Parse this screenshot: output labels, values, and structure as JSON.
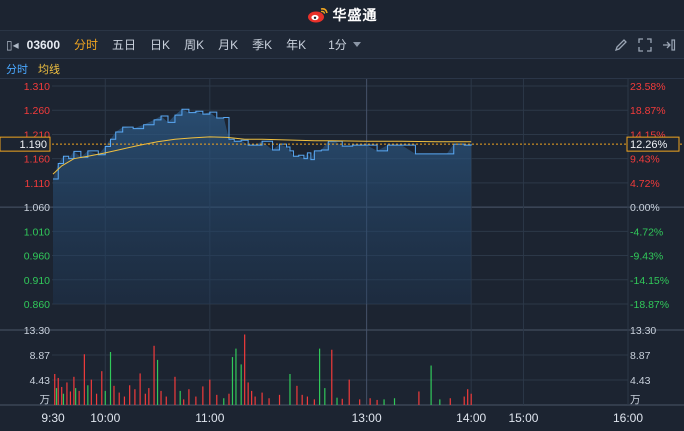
{
  "header": {
    "brand": "华盛通"
  },
  "toolbar": {
    "code": "03600",
    "tabs": [
      "分时",
      "五日",
      "日K",
      "周K",
      "月K",
      "季K",
      "年K"
    ],
    "active_tab": "分时",
    "interval": "1分"
  },
  "legend": {
    "intraday": "分时",
    "average": "均线"
  },
  "colors": {
    "up": "#f23b3b",
    "down": "#31c95a",
    "price": "#5aa9f5",
    "avg": "#f0c040",
    "bg": "#1c2431"
  },
  "chart_data": {
    "type": "line",
    "prev_close": 1.06,
    "current_price": "1.190",
    "current_pct": "12.26%",
    "price_ticks": [
      "1.310",
      "1.260",
      "1.210",
      "1.160",
      "1.110",
      "1.060",
      "1.010",
      "0.960",
      "0.910",
      "0.860"
    ],
    "pct_ticks": [
      "23.58%",
      "18.87%",
      "14.15%",
      "9.43%",
      "4.72%",
      "0.00%",
      "-4.72%",
      "-9.43%",
      "-14.15%",
      "-18.87%"
    ],
    "volume_ticks": [
      "13.30",
      "8.87",
      "4.43"
    ],
    "volume_unit": "万",
    "time_labels": [
      "9:30",
      "10:00",
      "11:00",
      "13:00",
      "14:00",
      "15:00",
      "16:00"
    ],
    "price_series": [
      [
        0,
        1.118
      ],
      [
        3,
        1.15
      ],
      [
        6,
        1.165
      ],
      [
        9,
        1.16
      ],
      [
        12,
        1.175
      ],
      [
        16,
        1.163
      ],
      [
        20,
        1.176
      ],
      [
        26,
        1.168
      ],
      [
        30,
        1.185
      ],
      [
        33,
        1.2
      ],
      [
        36,
        1.215
      ],
      [
        40,
        1.225
      ],
      [
        46,
        1.222
      ],
      [
        52,
        1.23
      ],
      [
        58,
        1.24
      ],
      [
        62,
        1.248
      ],
      [
        66,
        1.235
      ],
      [
        70,
        1.25
      ],
      [
        74,
        1.262
      ],
      [
        78,
        1.255
      ],
      [
        82,
        1.258
      ],
      [
        86,
        1.252
      ],
      [
        90,
        1.256
      ],
      [
        94,
        1.244
      ],
      [
        98,
        1.245
      ],
      [
        101,
        1.2
      ],
      [
        104,
        1.196
      ],
      [
        108,
        1.198
      ],
      [
        112,
        1.188
      ],
      [
        116,
        1.188
      ],
      [
        120,
        1.196
      ],
      [
        126,
        1.178
      ],
      [
        130,
        1.19
      ],
      [
        134,
        1.184
      ],
      [
        136,
        1.176
      ],
      [
        138,
        1.165
      ],
      [
        141,
        1.167
      ],
      [
        144,
        1.16
      ],
      [
        146,
        1.172
      ],
      [
        148,
        1.158
      ],
      [
        150,
        1.176
      ],
      [
        154,
        1.178
      ],
      [
        158,
        1.196
      ],
      [
        162,
        1.196
      ],
      [
        166,
        1.186
      ],
      [
        172,
        1.188
      ],
      [
        180,
        1.188
      ],
      [
        186,
        1.176
      ],
      [
        192,
        1.188
      ],
      [
        200,
        1.188
      ],
      [
        208,
        1.17
      ],
      [
        218,
        1.17
      ],
      [
        226,
        1.17
      ],
      [
        230,
        1.19
      ],
      [
        236,
        1.188
      ],
      [
        240,
        1.19
      ]
    ],
    "avg_series": [
      [
        0,
        1.128
      ],
      [
        5,
        1.145
      ],
      [
        12,
        1.16
      ],
      [
        20,
        1.165
      ],
      [
        30,
        1.172
      ],
      [
        40,
        1.18
      ],
      [
        50,
        1.188
      ],
      [
        60,
        1.195
      ],
      [
        70,
        1.2
      ],
      [
        80,
        1.203
      ],
      [
        90,
        1.205
      ],
      [
        100,
        1.204
      ],
      [
        110,
        1.2
      ],
      [
        120,
        1.2
      ],
      [
        130,
        1.199
      ],
      [
        140,
        1.198
      ],
      [
        150,
        1.197
      ],
      [
        160,
        1.197
      ],
      [
        180,
        1.196
      ],
      [
        200,
        1.196
      ],
      [
        220,
        1.195
      ],
      [
        240,
        1.195
      ]
    ],
    "volume_series": [
      [
        1,
        5.5,
        "up"
      ],
      [
        2,
        3.0,
        "down"
      ],
      [
        3,
        4.8,
        "up"
      ],
      [
        5,
        3.2,
        "up"
      ],
      [
        6,
        2.0,
        "down"
      ],
      [
        8,
        4.0,
        "up"
      ],
      [
        10,
        2.4,
        "up"
      ],
      [
        12,
        5.0,
        "up"
      ],
      [
        13,
        3.0,
        "down"
      ],
      [
        15,
        2.5,
        "up"
      ],
      [
        18,
        9.0,
        "up"
      ],
      [
        20,
        3.5,
        "down"
      ],
      [
        22,
        4.5,
        "up"
      ],
      [
        25,
        2.0,
        "up"
      ],
      [
        28,
        6.0,
        "up"
      ],
      [
        30,
        2.5,
        "down"
      ],
      [
        33,
        9.4,
        "down"
      ],
      [
        35,
        3.4,
        "up"
      ],
      [
        38,
        2.2,
        "up"
      ],
      [
        41,
        1.5,
        "up"
      ],
      [
        44,
        3.5,
        "up"
      ],
      [
        47,
        2.8,
        "up"
      ],
      [
        50,
        5.6,
        "up"
      ],
      [
        53,
        2.0,
        "up"
      ],
      [
        55,
        3.0,
        "up"
      ],
      [
        58,
        10.5,
        "up"
      ],
      [
        60,
        8.0,
        "down"
      ],
      [
        62,
        2.5,
        "up"
      ],
      [
        65,
        1.5,
        "up"
      ],
      [
        70,
        5.0,
        "up"
      ],
      [
        73,
        2.5,
        "down"
      ],
      [
        75,
        1.0,
        "up"
      ],
      [
        78,
        2.8,
        "up"
      ],
      [
        82,
        1.5,
        "up"
      ],
      [
        86,
        3.3,
        "up"
      ],
      [
        90,
        4.5,
        "up"
      ],
      [
        94,
        1.8,
        "up"
      ],
      [
        98,
        1.2,
        "down"
      ],
      [
        101,
        2.0,
        "up"
      ],
      [
        103,
        8.5,
        "down"
      ],
      [
        105,
        10.0,
        "down"
      ],
      [
        108,
        7.2,
        "down"
      ],
      [
        110,
        12.5,
        "up"
      ],
      [
        112,
        4.0,
        "up"
      ],
      [
        114,
        2.5,
        "up"
      ],
      [
        116,
        1.5,
        "up"
      ],
      [
        120,
        2.2,
        "up"
      ],
      [
        124,
        1.2,
        "up"
      ],
      [
        130,
        1.8,
        "up"
      ],
      [
        136,
        5.5,
        "down"
      ],
      [
        140,
        3.4,
        "up"
      ],
      [
        143,
        1.8,
        "up"
      ],
      [
        146,
        1.5,
        "up"
      ],
      [
        150,
        1.0,
        "up"
      ],
      [
        153,
        10.0,
        "down"
      ],
      [
        156,
        3.0,
        "down"
      ],
      [
        160,
        9.8,
        "up"
      ],
      [
        163,
        1.3,
        "down"
      ],
      [
        166,
        1.1,
        "up"
      ],
      [
        170,
        4.5,
        "up"
      ],
      [
        176,
        1.0,
        "up"
      ],
      [
        182,
        1.2,
        "up"
      ],
      [
        186,
        0.9,
        "up"
      ],
      [
        190,
        1.0,
        "down"
      ],
      [
        196,
        1.2,
        "down"
      ],
      [
        210,
        2.4,
        "up"
      ],
      [
        217,
        7.0,
        "down"
      ],
      [
        222,
        1.0,
        "down"
      ],
      [
        228,
        1.2,
        "up"
      ],
      [
        236,
        1.5,
        "up"
      ],
      [
        238,
        2.8,
        "up"
      ],
      [
        240,
        2.0,
        "up"
      ]
    ],
    "volume_max": 13.3
  }
}
